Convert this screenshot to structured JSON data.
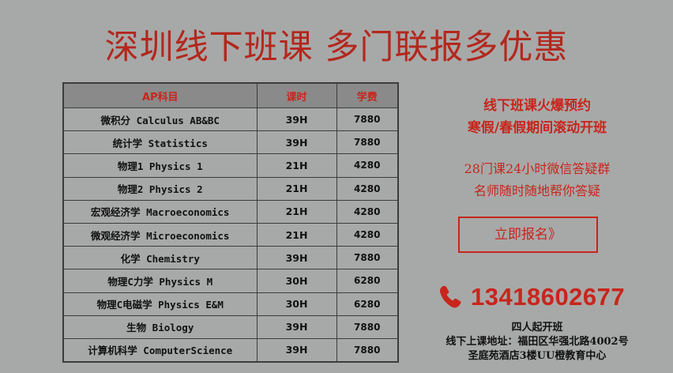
{
  "headline": "深圳线下班课 多门联报多优惠",
  "table": {
    "headers": {
      "subject": "AP科目",
      "hours": "课时",
      "fee": "学费"
    },
    "rows": [
      {
        "subject": "微积分 Calculus AB&BC",
        "hours": "39H",
        "fee": "7880"
      },
      {
        "subject": "统计学 Statistics",
        "hours": "39H",
        "fee": "7880"
      },
      {
        "subject": "物理1 Physics 1",
        "hours": "21H",
        "fee": "4280"
      },
      {
        "subject": "物理2 Physics 2",
        "hours": "21H",
        "fee": "4280"
      },
      {
        "subject": "宏观经济学 Macroeconomics",
        "hours": "21H",
        "fee": "4280"
      },
      {
        "subject": "微观经济学 Microeconomics",
        "hours": "21H",
        "fee": "4280"
      },
      {
        "subject": "化学 Chemistry",
        "hours": "39H",
        "fee": "7880"
      },
      {
        "subject": "物理C力学 Physics M",
        "hours": "30H",
        "fee": "6280"
      },
      {
        "subject": "物理C电磁学 Physics E&M",
        "hours": "30H",
        "fee": "6280"
      },
      {
        "subject": "生物 Biology",
        "hours": "39H",
        "fee": "7880"
      },
      {
        "subject": "计算机科学 ComputerScience",
        "hours": "39H",
        "fee": "7880"
      }
    ]
  },
  "promo": {
    "line1": "线下班课火爆预约",
    "line2": "寒假/春假期间滚动开班"
  },
  "service": {
    "line1": "28门课24小时微信答疑群",
    "line2": "名师随时随地帮你答疑"
  },
  "signup_button": "立即报名》",
  "contact": {
    "phone_icon": "phone-icon",
    "phone": "13418602677"
  },
  "info": {
    "line1": "四人起开班",
    "line2": "线下上课地址：福田区华强北路4002号",
    "line3": "圣庭苑酒店3楼UU橙教育中心"
  },
  "colors": {
    "background": "#a7a9a8",
    "accent_red": "#c8251c",
    "headline_red": "#b3271d",
    "table_header_bg": "#8a8a8a",
    "border": "#3c3c3c"
  }
}
